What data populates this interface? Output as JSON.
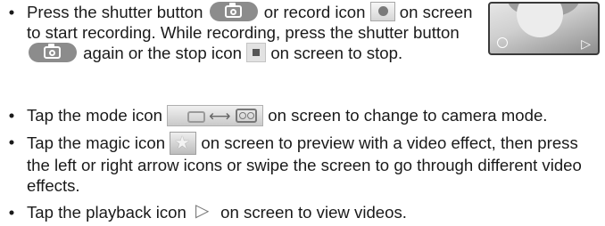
{
  "bullet": "•",
  "items": [
    {
      "p1": "Press the shutter button",
      "p2": "or record icon",
      "p3": "on screen to start recording. While recording, press the shutter button",
      "p4": "again or the stop icon",
      "p5": "on screen to stop."
    },
    {
      "p1": "Tap the mode icon",
      "p2": "on screen to change to camera mode."
    },
    {
      "p1": "Tap the magic icon",
      "p2": "on screen to preview with a video effect, then press the left or right arrow icons or swipe the screen to go through different video effects."
    },
    {
      "p1": "Tap the playback icon",
      "p2": "on screen to view videos."
    }
  ],
  "icons": {
    "shutter": "camera-shutter-button",
    "record": "record-dot-icon",
    "stop": "stop-square-icon",
    "mode": "camera-video-mode-icon",
    "magic": "star-magic-icon",
    "playback": "play-triangle-icon",
    "arrow_glyph": "⟷",
    "star_glyph": "★",
    "play_glyph": "▷"
  },
  "colors": {
    "text": "#1a1a1a",
    "shutter": "#8c8c8c",
    "icon_bg": "#d6d6d6"
  }
}
